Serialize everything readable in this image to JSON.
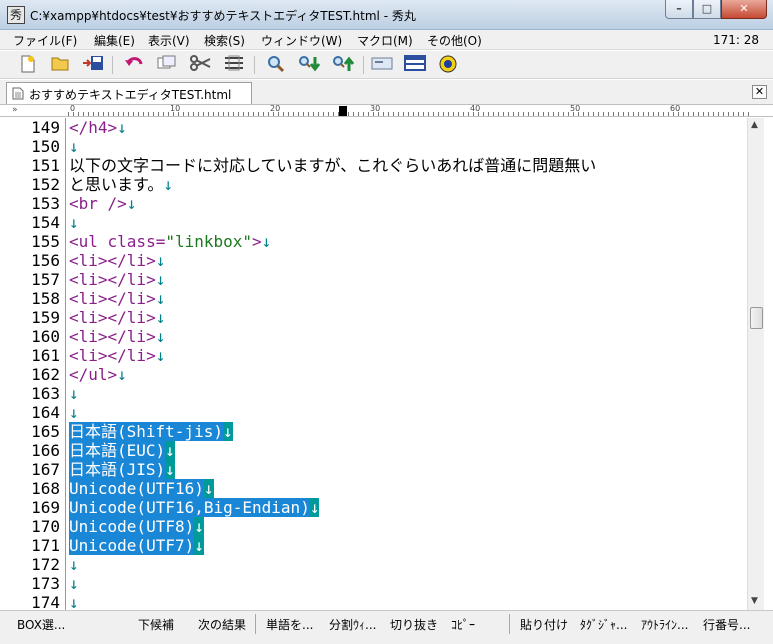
{
  "window": {
    "icon": "秀",
    "title": "C:¥xampp¥htdocs¥test¥おすすめテキストエディタTEST.html  - 秀丸",
    "minimize": "–",
    "maximize": "□",
    "close": "✕"
  },
  "menu": {
    "items": [
      "ファイル(F)",
      "編集(E)",
      "表示(V)",
      "検索(S)",
      "ウィンドウ(W)",
      "マクロ(M)",
      "その他(O)"
    ],
    "cursor_position": "171: 28"
  },
  "toolbar": {
    "icons": [
      "new-file-icon",
      "open-folder-icon",
      "save-icon",
      "undo-icon",
      "copy-icon",
      "cut-icon",
      "paste-icon",
      "find-icon",
      "find-next-down-icon",
      "find-next-up-icon",
      "grep-icon",
      "split-window-icon",
      "help-icon"
    ]
  },
  "tab": {
    "label": "おすすめテキストエディタTEST.html",
    "close": "✕"
  },
  "ruler": {
    "marker": "»",
    "numbers": [
      "0",
      "10",
      "20",
      "30",
      "40",
      "50",
      "60"
    ]
  },
  "editor": {
    "lines": [
      {
        "n": "149",
        "segments": [
          {
            "t": "</h4>",
            "c": "tag"
          },
          {
            "t": "↓",
            "c": "eol"
          }
        ]
      },
      {
        "n": "150",
        "segments": [
          {
            "t": "↓",
            "c": "eol"
          }
        ]
      },
      {
        "n": "151",
        "segments": [
          {
            "t": "以下の文字コードに対応していますが、これぐらいあれば普通に問題無い",
            "c": "text"
          }
        ]
      },
      {
        "n": "152",
        "segments": [
          {
            "t": "と思います。",
            "c": "text"
          },
          {
            "t": "↓",
            "c": "eol"
          }
        ]
      },
      {
        "n": "153",
        "segments": [
          {
            "t": "<br />",
            "c": "tag"
          },
          {
            "t": "↓",
            "c": "eol"
          }
        ]
      },
      {
        "n": "154",
        "segments": [
          {
            "t": "↓",
            "c": "eol"
          }
        ]
      },
      {
        "n": "155",
        "segments": [
          {
            "t": "<ul class=",
            "c": "tag"
          },
          {
            "t": "\"linkbox\"",
            "c": "str"
          },
          {
            "t": ">",
            "c": "tag"
          },
          {
            "t": "↓",
            "c": "eol"
          }
        ]
      },
      {
        "n": "156",
        "segments": [
          {
            "t": "<li></li>",
            "c": "tag"
          },
          {
            "t": "↓",
            "c": "eol"
          }
        ]
      },
      {
        "n": "157",
        "segments": [
          {
            "t": "<li></li>",
            "c": "tag"
          },
          {
            "t": "↓",
            "c": "eol"
          }
        ]
      },
      {
        "n": "158",
        "segments": [
          {
            "t": "<li></li>",
            "c": "tag"
          },
          {
            "t": "↓",
            "c": "eol"
          }
        ]
      },
      {
        "n": "159",
        "segments": [
          {
            "t": "<li></li>",
            "c": "tag"
          },
          {
            "t": "↓",
            "c": "eol"
          }
        ]
      },
      {
        "n": "160",
        "segments": [
          {
            "t": "<li></li>",
            "c": "tag"
          },
          {
            "t": "↓",
            "c": "eol"
          }
        ]
      },
      {
        "n": "161",
        "segments": [
          {
            "t": "<li></li>",
            "c": "tag"
          },
          {
            "t": "↓",
            "c": "eol"
          }
        ]
      },
      {
        "n": "162",
        "segments": [
          {
            "t": "</ul>",
            "c": "tag"
          },
          {
            "t": "↓",
            "c": "eol"
          }
        ]
      },
      {
        "n": "163",
        "segments": [
          {
            "t": "↓",
            "c": "eol"
          }
        ]
      },
      {
        "n": "164",
        "segments": [
          {
            "t": "↓",
            "c": "eol"
          }
        ]
      },
      {
        "n": "165",
        "segments": [
          {
            "t": "日本語(Shift-jis)",
            "c": "sel"
          },
          {
            "t": "↓",
            "c": "sel-eol"
          }
        ]
      },
      {
        "n": "166",
        "segments": [
          {
            "t": "日本語(EUC)",
            "c": "sel"
          },
          {
            "t": "↓",
            "c": "sel-eol"
          }
        ]
      },
      {
        "n": "167",
        "segments": [
          {
            "t": "日本語(JIS)",
            "c": "sel"
          },
          {
            "t": "↓",
            "c": "sel-eol"
          }
        ]
      },
      {
        "n": "168",
        "segments": [
          {
            "t": "Unicode(UTF16)",
            "c": "sel"
          },
          {
            "t": "↓",
            "c": "sel-eol"
          }
        ]
      },
      {
        "n": "169",
        "segments": [
          {
            "t": "Unicode(UTF16,Big-Endian)",
            "c": "sel"
          },
          {
            "t": "↓",
            "c": "sel-eol"
          }
        ]
      },
      {
        "n": "170",
        "segments": [
          {
            "t": "Unicode(UTF8)",
            "c": "sel"
          },
          {
            "t": "↓",
            "c": "sel-eol"
          }
        ]
      },
      {
        "n": "171",
        "segments": [
          {
            "t": "Unicode(UTF7)",
            "c": "sel"
          },
          {
            "t": "↓",
            "c": "sel-eol"
          }
        ]
      },
      {
        "n": "172",
        "segments": [
          {
            "t": "↓",
            "c": "eol"
          }
        ]
      },
      {
        "n": "173",
        "segments": [
          {
            "t": "↓",
            "c": "eol"
          }
        ]
      },
      {
        "n": "174",
        "segments": [
          {
            "t": "↓",
            "c": "eol"
          }
        ]
      }
    ]
  },
  "scrollbar": {
    "up": "▲",
    "down": "▼"
  },
  "function_keys": [
    "BOX選...",
    "下候補",
    "次の結果",
    "単語を...",
    "分割ｳｨ...",
    "切り抜き",
    "ｺﾋﾟｰ",
    "貼り付け",
    "ﾀｸﾞｼﾞｬ...",
    "ｱｳﾄﾗｲﾝ...",
    "行番号..."
  ],
  "colors": {
    "tag": "#8a1f8a",
    "string": "#1c7a20",
    "eol": "#00808a",
    "selection": "#1a86d6",
    "selection_eol": "#009a9a"
  }
}
